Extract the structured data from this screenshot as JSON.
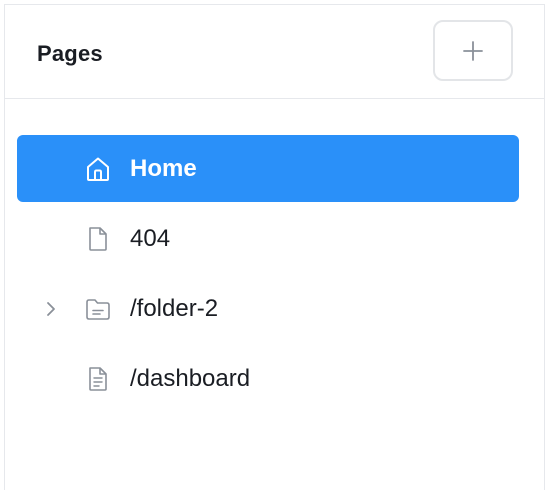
{
  "header": {
    "title": "Pages",
    "add_icon": "plus-icon"
  },
  "pages": [
    {
      "label": "Home",
      "icon": "home-icon",
      "active": true,
      "expandable": false
    },
    {
      "label": "404",
      "icon": "file-icon",
      "active": false,
      "expandable": false
    },
    {
      "label": "/folder-2",
      "icon": "folder-icon",
      "active": false,
      "expandable": true
    },
    {
      "label": "/dashboard",
      "icon": "file-text-icon",
      "active": false,
      "expandable": false
    }
  ],
  "colors": {
    "accent": "#2a90f9",
    "text": "#1a1d23",
    "icon": "#8a9099",
    "border": "#e6e8ec"
  }
}
